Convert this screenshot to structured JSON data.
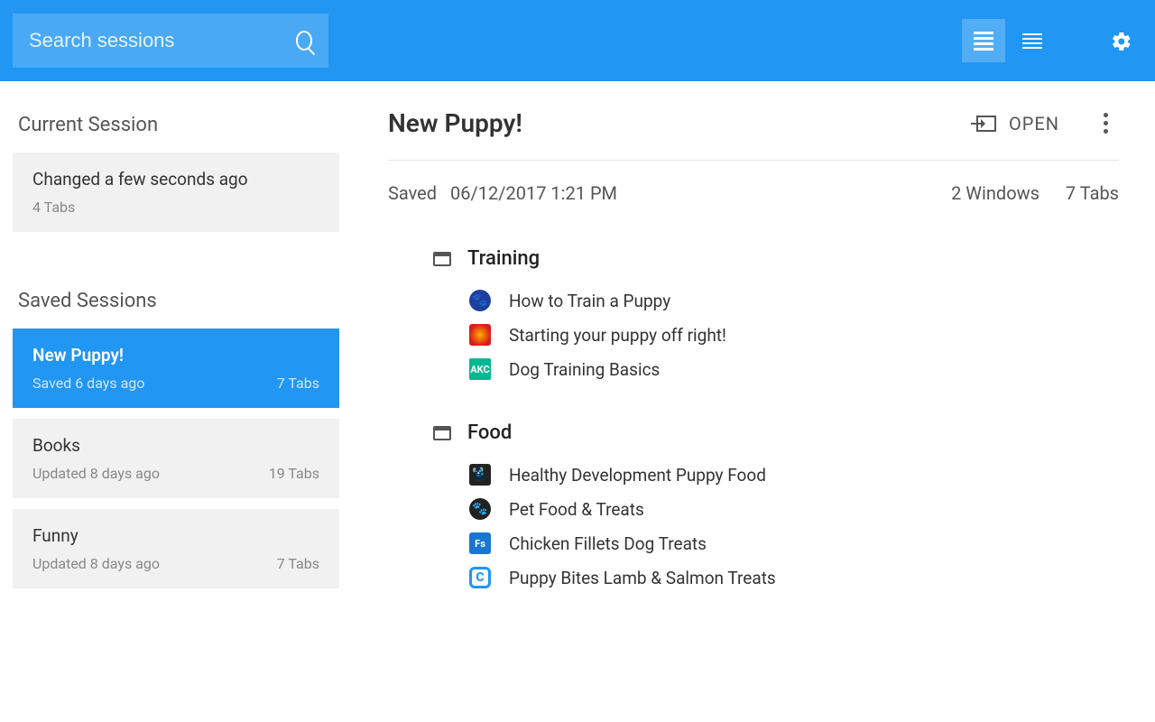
{
  "search": {
    "placeholder": "Search sessions"
  },
  "sidebar": {
    "current_heading": "Current Session",
    "saved_heading": "Saved Sessions",
    "current": {
      "title": "Changed a few seconds ago",
      "subtitle": "4 Tabs"
    },
    "saved": [
      {
        "title": "New Puppy!",
        "left": "Saved 6 days ago",
        "right": "7 Tabs",
        "selected": true
      },
      {
        "title": "Books",
        "left": "Updated 8 days ago",
        "right": "19 Tabs",
        "selected": false
      },
      {
        "title": "Funny",
        "left": "Updated 8 days ago",
        "right": "7 Tabs",
        "selected": false
      }
    ]
  },
  "detail": {
    "title": "New Puppy!",
    "open_label": "OPEN",
    "saved_label": "Saved",
    "saved_time": "06/12/2017 1:21 PM",
    "windows_count": "2 Windows",
    "tabs_count": "7 Tabs",
    "windows": [
      {
        "name": "Training",
        "tabs": [
          {
            "favicon": "paw",
            "text": "How to Train a Puppy"
          },
          {
            "favicon": "swirl",
            "text": "Starting your puppy off right!"
          },
          {
            "favicon": "akc",
            "text": "Dog Training Basics",
            "icon_text": "AKC"
          }
        ]
      },
      {
        "name": "Food",
        "tabs": [
          {
            "favicon": "dog",
            "text": "Healthy Development Puppy Food"
          },
          {
            "favicon": "paw2",
            "text": "Pet Food & Treats"
          },
          {
            "favicon": "fs",
            "text": "Chicken Fillets Dog Treats",
            "icon_text": "Fs"
          },
          {
            "favicon": "c",
            "text": "Puppy Bites Lamb & Salmon Treats",
            "icon_text": "C"
          }
        ]
      }
    ]
  }
}
